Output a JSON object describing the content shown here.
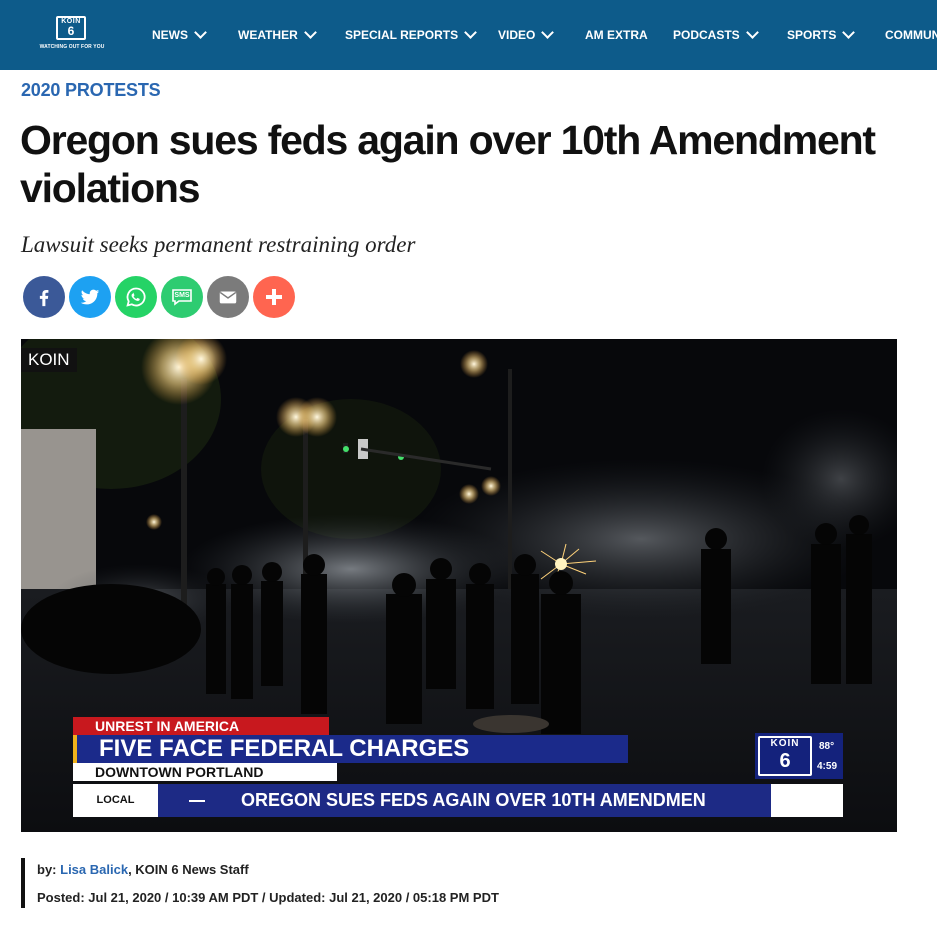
{
  "header": {
    "logo_top": "KOIN",
    "logo_number": "6",
    "logo_tagline": "WATCHING OUT FOR YOU",
    "nav": [
      {
        "label": "NEWS",
        "has_dropdown": true
      },
      {
        "label": "WEATHER",
        "has_dropdown": true
      },
      {
        "label": "SPECIAL REPORTS",
        "has_dropdown": true
      },
      {
        "label": "VIDEO",
        "has_dropdown": true
      },
      {
        "label": "AM EXTRA",
        "has_dropdown": false
      },
      {
        "label": "PODCASTS",
        "has_dropdown": true
      },
      {
        "label": "SPORTS",
        "has_dropdown": true
      },
      {
        "label": "COMMUNI",
        "has_dropdown": false
      }
    ],
    "bg_color": "#0d5b8a"
  },
  "article": {
    "category": "2020 PROTESTS",
    "headline": "Oregon sues feds again over 10th Amendment violations",
    "subhead": "Lawsuit seeks permanent restraining order",
    "share": [
      {
        "icon": "facebook-icon",
        "color": "#3b5998"
      },
      {
        "icon": "twitter-icon",
        "color": "#1da1f2"
      },
      {
        "icon": "whatsapp-icon",
        "color": "#25d366"
      },
      {
        "icon": "sms-icon",
        "color": "#2ecc71"
      },
      {
        "icon": "email-icon",
        "color": "#7b7b7b"
      },
      {
        "icon": "plus-icon",
        "color": "#ff6550"
      }
    ],
    "sms_label": "SMS"
  },
  "video": {
    "bug": "KOIN",
    "lower_third_top": "UNREST IN AMERICA",
    "lower_third_main": "FIVE FACE FEDERAL CHARGES",
    "lower_third_sub": "DOWNTOWN PORTLAND",
    "ticker_label": "LOCAL",
    "ticker_text": "OREGON SUES FEDS AGAIN OVER 10TH AMENDMEN",
    "station_koin": "KOIN",
    "station_number": "6",
    "temperature": "88°",
    "time": "4:59"
  },
  "byline": {
    "by_prefix": "by: ",
    "author": "Lisa Balick",
    "author_suffix": ", KOIN 6 News Staff",
    "posted": "Posted: Jul 21, 2020 / 10:39 AM PDT / Updated: Jul 21, 2020 / 05:18 PM PDT"
  }
}
